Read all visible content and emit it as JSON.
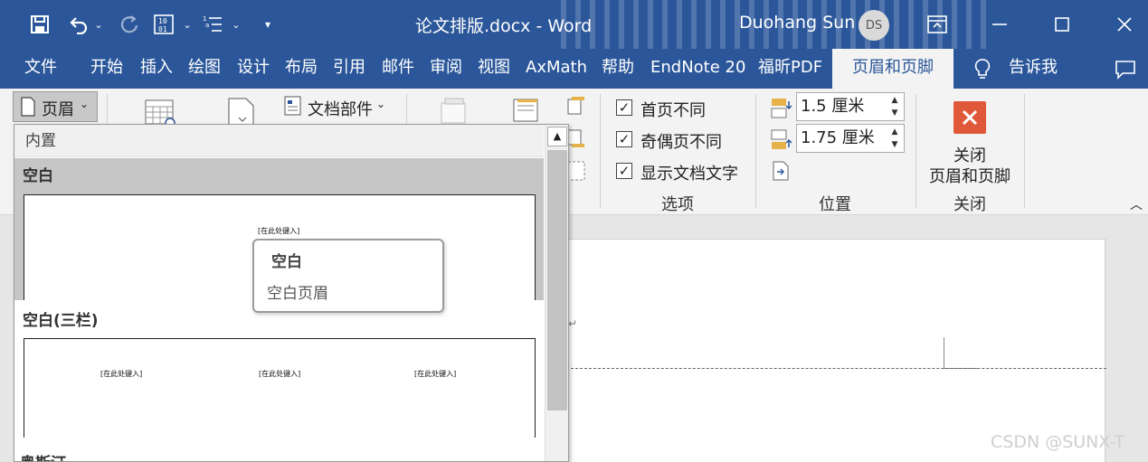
{
  "titlebar": {
    "doc_title": "论文排版.docx  -  Word",
    "user_name": "Duohang Sun",
    "avatar_initials": "DS",
    "icons": [
      "save-icon",
      "undo-icon",
      "redo-icon",
      "number-format-icon",
      "list-format-icon",
      "customize-qat-icon",
      "ribbon-display-icon",
      "minimize-icon",
      "maximize-icon",
      "close-icon"
    ]
  },
  "tabs": [
    "文件",
    "开始",
    "插入",
    "绘图",
    "设计",
    "布局",
    "引用",
    "邮件",
    "审阅",
    "视图",
    "AxMath",
    "帮助",
    "EndNote 20",
    "福昕PDF",
    "页眉和页脚"
  ],
  "tell_me": "告诉我",
  "ribbon": {
    "header_button": "页眉",
    "doc_parts": "文档部件",
    "options": {
      "items": [
        "首页不同",
        "奇偶页不同",
        "显示文档文字"
      ],
      "checked": [
        true,
        true,
        true
      ],
      "label": "选项"
    },
    "position": {
      "header_top": "1.5 厘米",
      "footer_bottom": "1.75 厘米",
      "label": "位置"
    },
    "close": {
      "button_line1": "关闭",
      "button_line2": "页眉和页脚",
      "label": "关闭"
    }
  },
  "gallery": {
    "section": "内置",
    "items": [
      {
        "title": "空白",
        "placeholders": [
          "[在此处键入]"
        ]
      },
      {
        "title": "空白(三栏)",
        "placeholders": [
          "[在此处键入]",
          "[在此处键入]",
          "[在此处键入]"
        ]
      },
      {
        "title": "奥斯汀"
      }
    ]
  },
  "tooltip": {
    "title": "空白",
    "description": "空白页眉"
  },
  "document": {
    "paragraph_mark": "↵"
  },
  "watermark": "CSDN @SUNX-T",
  "colors": {
    "word_blue": "#2b579a",
    "close_red": "#e0583a",
    "ribbon_bg": "#f3f3f3"
  }
}
